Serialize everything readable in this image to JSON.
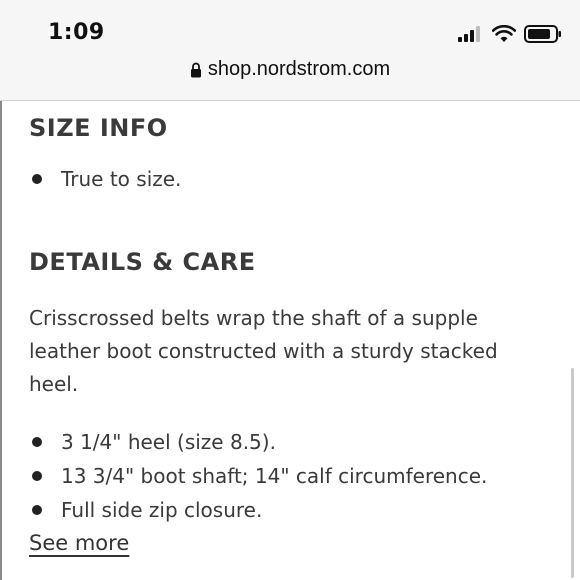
{
  "status_bar": {
    "time": "1:09"
  },
  "browser": {
    "url": "shop.nordstrom.com"
  },
  "size_info": {
    "title": "SIZE INFO",
    "items": [
      "True to size."
    ]
  },
  "details_care": {
    "title": "DETAILS & CARE",
    "description": "Crisscrossed belts wrap the shaft of a supple leather boot constructed with a sturdy stacked heel.",
    "items": [
      "3 1/4\" heel (size 8.5).",
      "13 3/4\" boot shaft; 14\" calf circumference.",
      "Full side zip closure."
    ],
    "see_more": "See more"
  },
  "icons": {
    "signal": "cellular-signal-icon",
    "wifi": "wifi-icon",
    "battery": "battery-icon",
    "lock": "lock-icon"
  }
}
